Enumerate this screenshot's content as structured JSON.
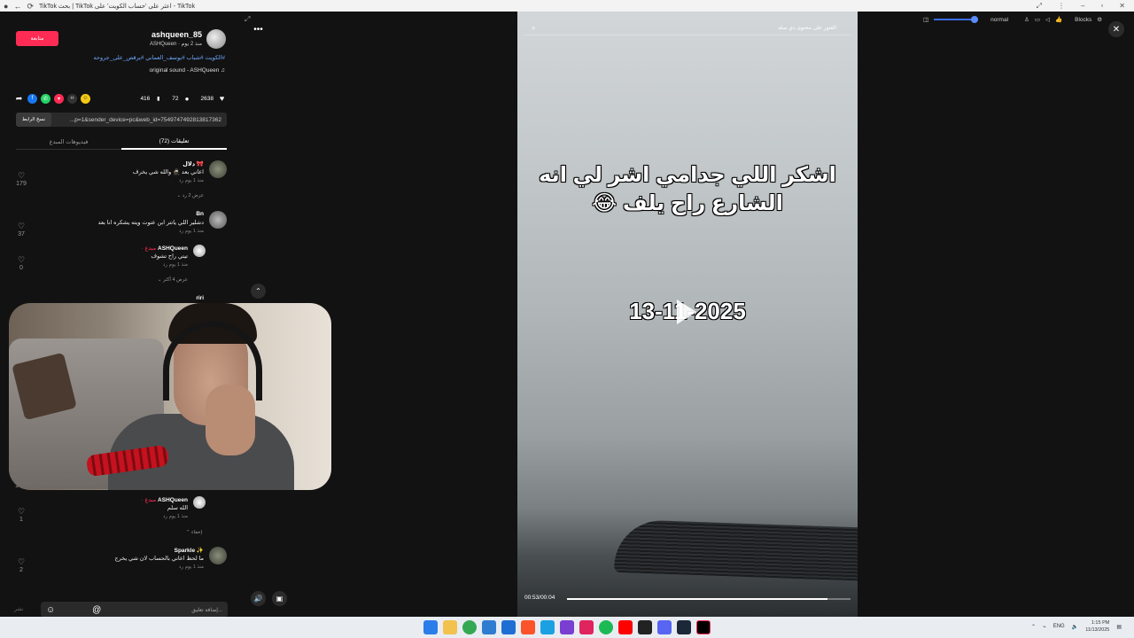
{
  "browser": {
    "tab_title": "TikTok بحث | TikTok اعثر على 'حساب الكويت' على - TikTok",
    "nav_back": "←",
    "nav_reload": "⟳"
  },
  "post": {
    "username": "ashqueen_85",
    "subline": "ASHQueen · منذ 2 يوم",
    "follow_label": "متابعة",
    "hashtags": "#الكويت #شباب #يوسف_العماني #يرقص_على_جروحه",
    "sound": "original sound - ASHQueen ♫",
    "likes": "2638",
    "comments": "72",
    "saves": "416",
    "link": "...p=1&sender_device=pc&web_id=7549747492813817362",
    "copy_label": "نسخ الرابط"
  },
  "tabs": {
    "comments": "تعليقات (72)",
    "creator_videos": "فيديوهات المبدع"
  },
  "comments": [
    {
      "name": "دلال 🎀",
      "text": "اعاني بعد 🥷🏻 والله شي يخرف",
      "meta": "منذ 1 يوم   رد",
      "likes": "179",
      "replies": "عرض 2 رد ⌄"
    },
    {
      "name": "Bn",
      "text": "دشلير اللي ياتتر ابن عتوت ويته يشكره انا بعد",
      "meta": "منذ 1 يوم   رد",
      "likes": "37"
    },
    {
      "name": "ASHQueen",
      "creator": "· مبدع",
      "text": "تيتي راح تشوف",
      "meta": "منذ 1 يوم   رد",
      "likes": "0",
      "replies": "عرض 4 أكثر ⌄"
    },
    {
      "name": "riri",
      "text": "",
      "meta": "",
      "likes": ""
    },
    {
      "name": "ASHQueen",
      "creator": "· مبدع",
      "text": "الله سلم",
      "meta": "منذ 1 يوم   رد",
      "likes": "1",
      "replies": "إخفاء ⌃"
    },
    {
      "name": "Sparkle ✨",
      "text": "ما لحظ اعاني بالحساب لان شي يخرج",
      "meta": "منذ 1 يوم   رد",
      "likes": "2"
    }
  ],
  "first_like_partial": "1",
  "input": {
    "placeholder": "إضافة تعليق...",
    "post_label": "نشر",
    "emoji": "☺",
    "mention": "@"
  },
  "video": {
    "search_placeholder": "العثور على محتوى ذي صلة",
    "caption_line1": "اشكر اللي جدامي اشر لي انه",
    "caption_line2": "الشارع راح يلف 😂",
    "date_text": "13-11-2025",
    "time": "00:53/00:04",
    "progress": 0.92
  },
  "controls": {
    "mode": "normal",
    "blocks": "Blocks"
  },
  "taskbar": {
    "time": "1:15 PM",
    "date": "11/13/2025",
    "lang": "ENG"
  }
}
